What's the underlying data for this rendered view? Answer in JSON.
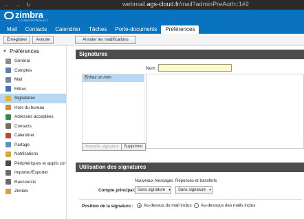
{
  "browser": {
    "url_prefix": "webmail.",
    "url_domain": "ags-cloud.fr",
    "url_suffix": "/mail?adminPreAuth=1#2"
  },
  "brand": {
    "name": "zimbra",
    "tagline": "A SYNACOR PRODUCT"
  },
  "app_tabs": [
    {
      "label": "Mail"
    },
    {
      "label": "Contacts"
    },
    {
      "label": "Calendrier"
    },
    {
      "label": "Tâches"
    },
    {
      "label": "Porte-documents"
    },
    {
      "label": "Préférences",
      "active": true
    }
  ],
  "toolbar": {
    "save": "Enregistrer",
    "cancel": "Annuler",
    "undo_changes": "Annuler les modifications"
  },
  "sidebar": {
    "header": "Préférences",
    "items": [
      {
        "label": "Général",
        "icon": "gear-icon",
        "color": "#8a8f96"
      },
      {
        "label": "Comptes",
        "icon": "accounts-icon",
        "color": "#5b7fae"
      },
      {
        "label": "Mail",
        "icon": "mail-icon",
        "color": "#6d87a8"
      },
      {
        "label": "Filtres",
        "icon": "filter-icon",
        "color": "#3e73b5"
      },
      {
        "label": "Signatures",
        "icon": "signature-icon",
        "color": "#e2b432",
        "selected": true
      },
      {
        "label": "Hors du bureau",
        "icon": "out-of-office-icon",
        "color": "#d08a3a"
      },
      {
        "label": "Adresses acceptées",
        "icon": "shield-check-icon",
        "color": "#2f8f3a"
      },
      {
        "label": "Contacts",
        "icon": "contacts-icon",
        "color": "#7a6a5a"
      },
      {
        "label": "Calendrier",
        "icon": "calendar-icon",
        "color": "#c0453b"
      },
      {
        "label": "Partage",
        "icon": "share-icon",
        "color": "#5f8fc4"
      },
      {
        "label": "Notifications",
        "icon": "bell-icon",
        "color": "#d9a83a"
      },
      {
        "label": "Périphériques et applis conn",
        "icon": "devices-icon",
        "color": "#4a4a4a"
      },
      {
        "label": "Importer/Exporter",
        "icon": "import-export-icon",
        "color": "#6d6d6d"
      },
      {
        "label": "Raccourcis",
        "icon": "keyboard-icon",
        "color": "#6b6b6b"
      },
      {
        "label": "Zimlets",
        "icon": "zimlet-icon",
        "color": "#d6a33a"
      }
    ]
  },
  "signatures": {
    "title": "Signatures",
    "name_label": "Nom :",
    "name_value": "",
    "list_item": "Entrez un nom",
    "new_button": "Nouvelle signature",
    "delete_button": "Supprimer"
  },
  "usage": {
    "title": "Utilisation des signatures",
    "col_new_messages": "Nouveaux messages",
    "col_replies": "Réponses et transferts",
    "account_label": "Compte principal:",
    "new_select": "Sans signature",
    "reply_select": "Sans signature",
    "position_label": "Position de la signature :",
    "option_above": "Au-dessus du mail inclus",
    "option_below": "Au-dessous des mails inclus"
  }
}
